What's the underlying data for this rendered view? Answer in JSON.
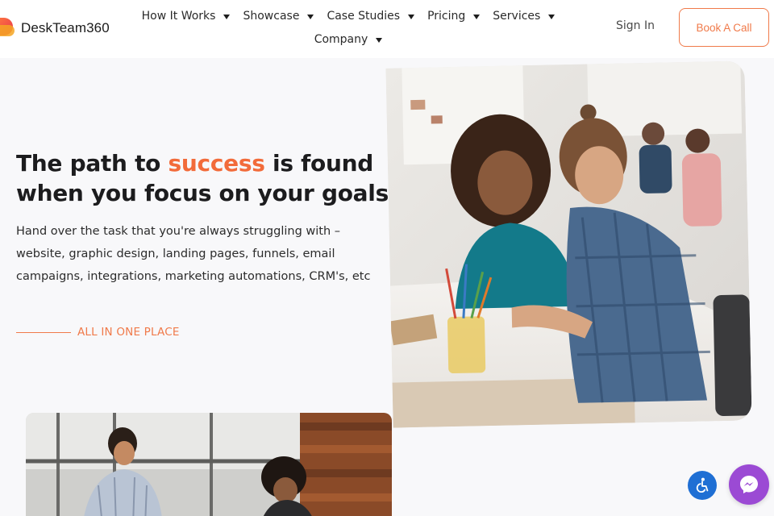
{
  "brand": {
    "name": "DeskTeam360",
    "colors": {
      "accent": "#f26b3a",
      "primary_text": "#1c1c1e",
      "accessibility": "#1f6fd4",
      "messenger": "#9b4ad4"
    }
  },
  "nav": {
    "items": [
      {
        "label": "How It Works"
      },
      {
        "label": "Showcase"
      },
      {
        "label": "Case Studies"
      },
      {
        "label": "Pricing"
      },
      {
        "label": "Services"
      },
      {
        "label": "Company"
      }
    ]
  },
  "header": {
    "sign_in": "Sign In",
    "book_call": "Book A Call"
  },
  "hero": {
    "headline_part1": "The path to ",
    "headline_accent": "success",
    "headline_part2": " is found when you focus on your goals",
    "subtext": "Hand over the task that you're always struggling with – website, graphic design, landing pages, funnels, email campaigns, integrations, marketing automations, CRM's, etc",
    "tagline": "ALL IN ONE PLACE"
  },
  "icons": {
    "accessibility": "accessibility-icon",
    "messenger": "messenger-icon",
    "caret": "chevron-down-icon"
  }
}
